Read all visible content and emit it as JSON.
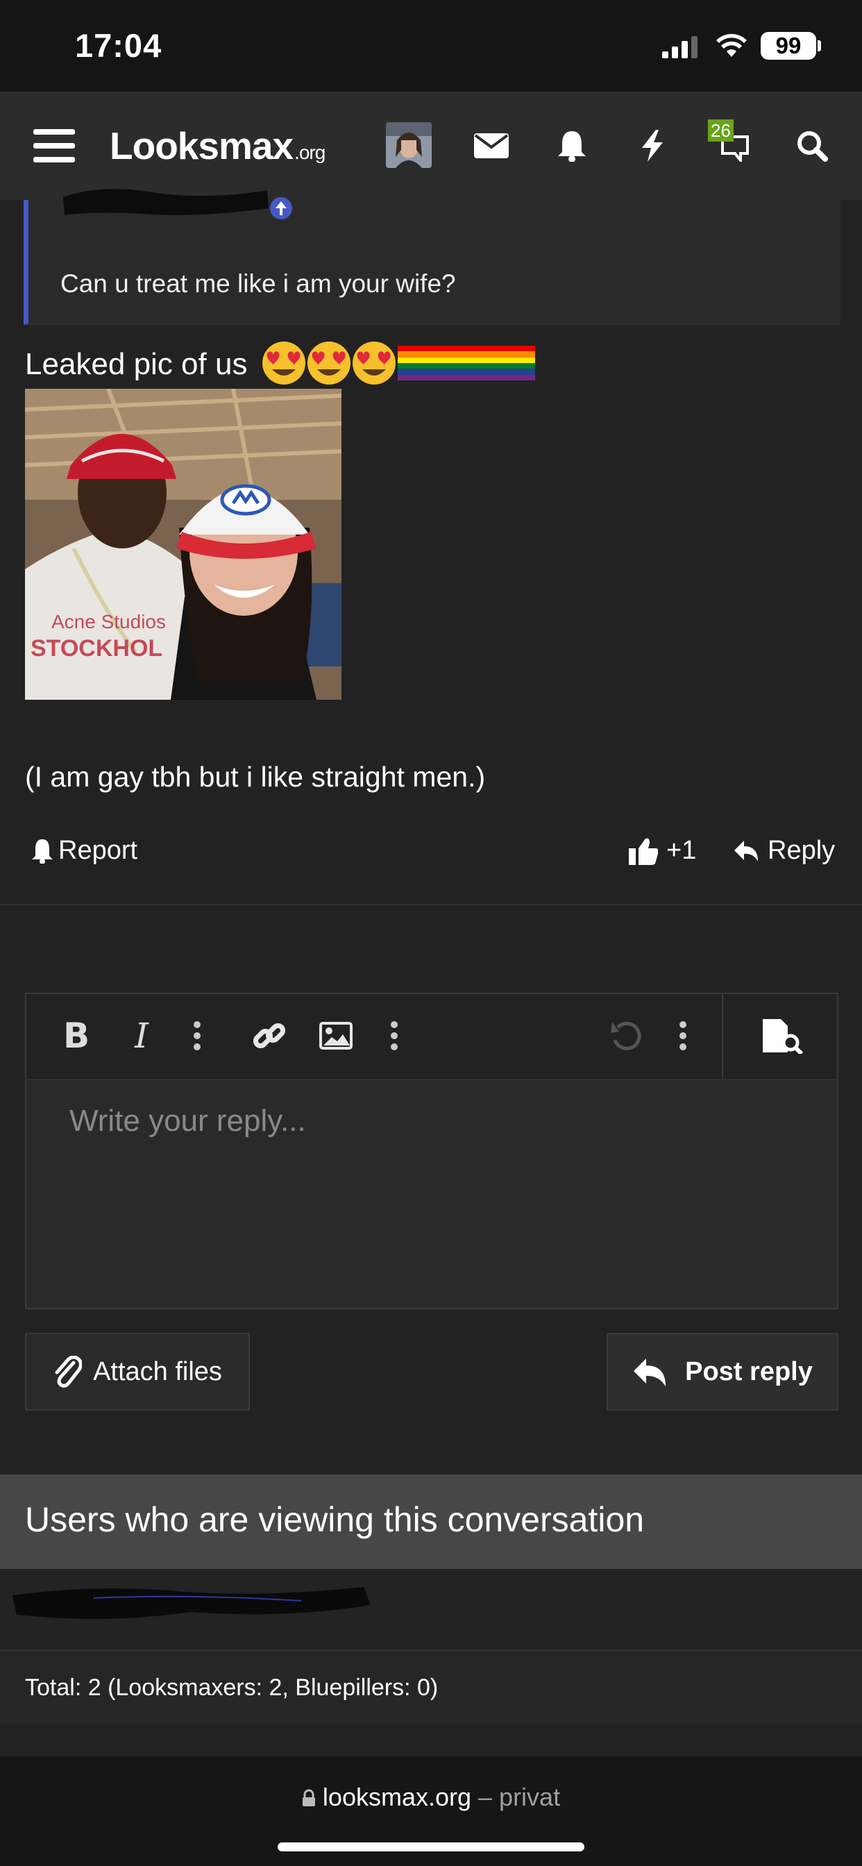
{
  "status_bar": {
    "time": "17:04",
    "battery": "99"
  },
  "header": {
    "logo": "Looksmax",
    "logo_suffix": ".org",
    "conversations_badge": "26"
  },
  "quote": {
    "text": "Can u treat me like i am your wife?"
  },
  "post": {
    "text_line1": "Leaked pic of us",
    "photo_text_line1": "Acne Studios",
    "photo_text_line2": "STOCKHOL",
    "text_line2": "(I am gay tbh but i like straight men.)",
    "report_label": "Report",
    "like_count": "+1",
    "reply_label": "Reply"
  },
  "editor": {
    "placeholder": "Write your reply...",
    "attach_label": "Attach files",
    "post_label": "Post reply"
  },
  "viewers": {
    "title": "Users who are viewing this conversation",
    "total": "Total: 2 (Looksmaxers: 2, Bluepillers: 0)"
  },
  "browser": {
    "url": "looksmax.org",
    "mode": "privat"
  },
  "colors": {
    "background": "#222222",
    "header": "#2c2c2c",
    "quote_accent": "#4659c4",
    "badge": "#6aa31b"
  }
}
